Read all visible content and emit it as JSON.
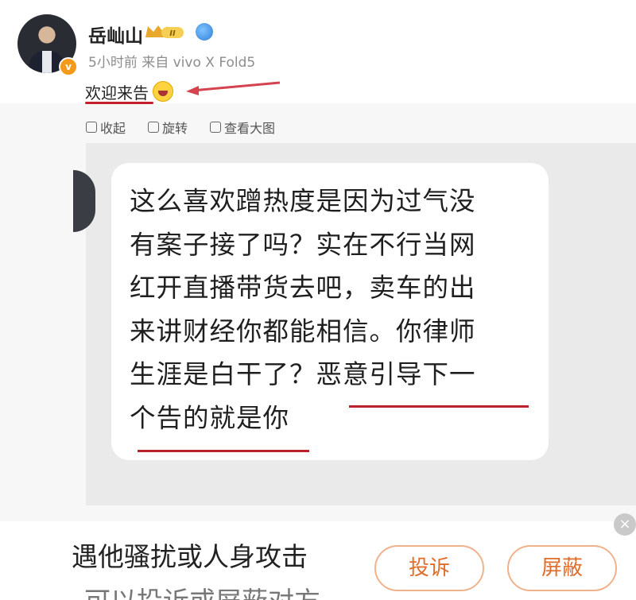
{
  "post": {
    "author": "岳屾山",
    "meta": "5小时前 来自 vivo X Fold5",
    "text": "欢迎来告",
    "badge_text": "II",
    "actions": {
      "favorite": "收起",
      "rotate": "旋转",
      "view_large": "查看大图"
    }
  },
  "message": {
    "lines": [
      "这么喜欢蹭热度是因为过气没",
      "有案子接了吗？实在不行当网",
      "红开直播带货去吧，卖车的出",
      "来讲财经你都能相信。你律师",
      "生涯是白干了？恶意引导下一",
      "个告的就是你"
    ]
  },
  "bottom": {
    "line1": "遇他骚扰或人身攻击",
    "line2": "可以投诉或屏蔽对方",
    "complain_label": "投诉",
    "block_label": "屏蔽"
  },
  "colors": {
    "accent": "#e06d2a",
    "underline": "#b9222b",
    "verified": "#f39a18"
  }
}
